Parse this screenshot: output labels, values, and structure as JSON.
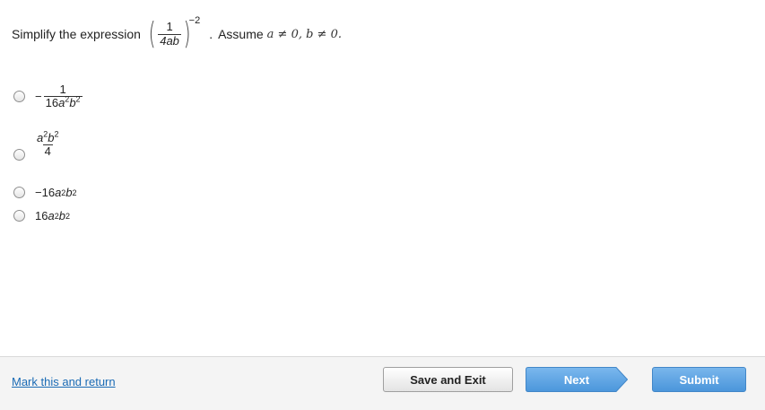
{
  "question": {
    "prefix": "Simplify the expression",
    "frac_num": "1",
    "frac_den": "4ab",
    "exponent": "−2",
    "dot": ".",
    "assume_label": "Assume",
    "condition": "a ≠ 0, b ≠ 0."
  },
  "options": [
    {
      "sign": "−",
      "num": "1",
      "den_coef": "16",
      "den_a": "a",
      "den_a_exp": "2",
      "den_b": "b",
      "den_b_exp": "2"
    },
    {
      "num_a": "a",
      "num_a_exp": "2",
      "num_b": "b",
      "num_b_exp": "2",
      "den": "4"
    },
    {
      "sign": "−",
      "coef": "16",
      "a": "a",
      "a_exp": "2",
      "b": "b",
      "b_exp": "2"
    },
    {
      "coef": "16",
      "a": "a",
      "a_exp": "2",
      "b": "b",
      "b_exp": "2"
    }
  ],
  "footer": {
    "mark_link": "Mark this and return",
    "save_label": "Save and Exit",
    "next_label": "Next",
    "submit_label": "Submit"
  },
  "colors": {
    "link": "#1a6bb5",
    "next_button": "#5ea6e6",
    "submit_button": "#5ea6e6"
  }
}
